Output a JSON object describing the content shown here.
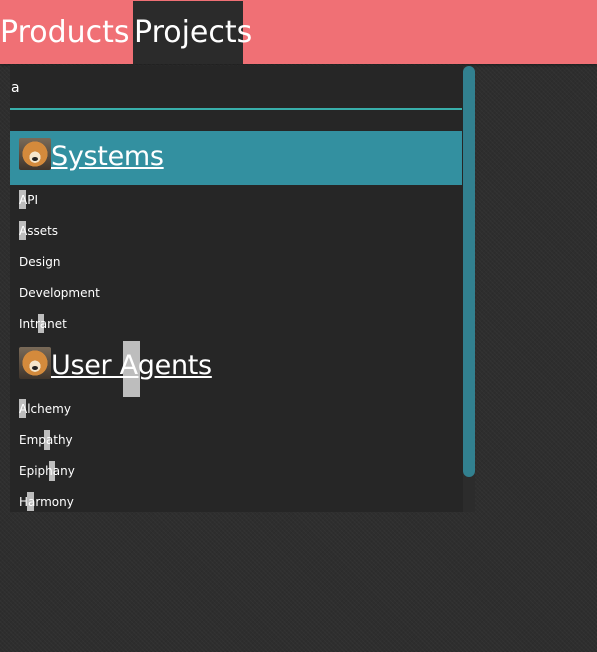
{
  "nav": {
    "tabs": [
      {
        "label": "Products"
      },
      {
        "label": "Projects"
      }
    ]
  },
  "search": {
    "value": "a"
  },
  "groups": [
    {
      "label": "Systems",
      "items": [
        {
          "label": "API"
        },
        {
          "label": "Assets"
        },
        {
          "label": "Design"
        },
        {
          "label": "Development"
        },
        {
          "label": "Intranet"
        }
      ]
    },
    {
      "label": "User Agents",
      "items": [
        {
          "label": "Alchemy"
        },
        {
          "label": "Empathy"
        },
        {
          "label": "Epiphany"
        },
        {
          "label": "Harmony"
        }
      ]
    }
  ],
  "colors": {
    "topbar": "#f07075",
    "active_tab": "#2b2b2b",
    "accent_teal": "#3390a0",
    "search_underline": "#38aeaa",
    "highlight": "#bdbdbd"
  }
}
